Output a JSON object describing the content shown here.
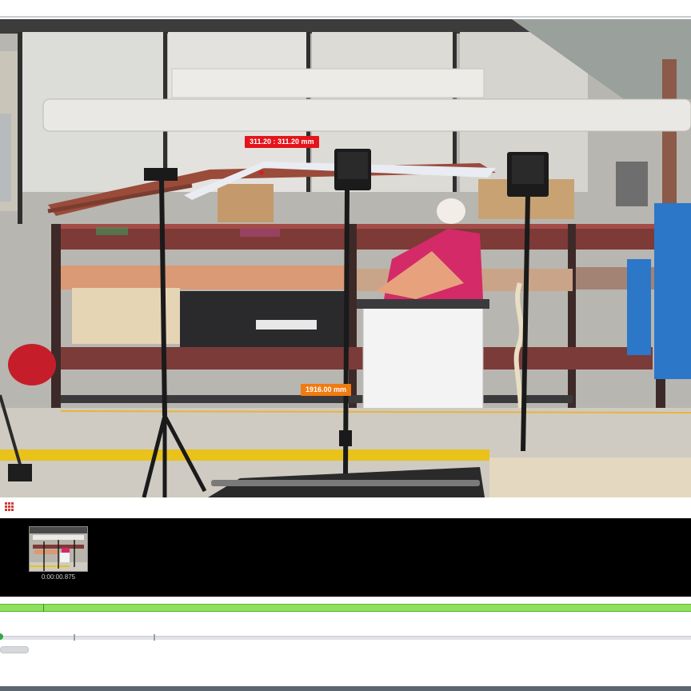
{
  "viewer": {
    "measurement_top": "311.20 : 311.20 mm",
    "measurement_mid": "1916.00 mm",
    "measurement_top_color": "#e5141a",
    "measurement_mid_color": "#f07b12"
  },
  "timeline": {
    "thumbnail_time": "0:00:00.875"
  },
  "colors": {
    "track": "#8fe05a",
    "playhead": "#2fa84a",
    "timeline_bg": "#000000"
  },
  "icons": {
    "view_toggle": "grid-icon"
  }
}
